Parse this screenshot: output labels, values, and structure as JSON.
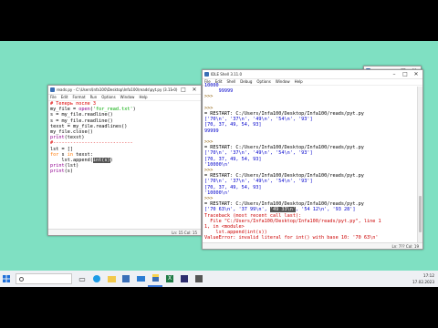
{
  "editor_window": {
    "title": "reads.py - C:\\Users\\Infa100\\Desktop\\Infa100\\reads\\pyt.py (3.11.0)",
    "menu": [
      "File",
      "Edit",
      "Format",
      "Run",
      "Options",
      "Window",
      "Help"
    ],
    "status": "Ln: 15   Col: 15"
  },
  "shell_window": {
    "title": "IDLE Shell 3.11.0",
    "menu": [
      "File",
      "Edit",
      "Shell",
      "Debug",
      "Options",
      "Window",
      "Help"
    ],
    "status": "Ln: 7??   Col: 19",
    "out_top1": "10000",
    "out_top2": "99999",
    "prompt": ">>>",
    "restart": "= RESTART: C:/Users/Infa100/Desktop/Infa100/reads/pyt.py",
    "list_str": "['70\\n', '37\\n', '49\\n', '54\\n', '93']",
    "list_int": "[70, 37, 49, 54, 93]",
    "out_99999": "99999",
    "out_10000": "'10000\\n'",
    "bad_pre": "['70 63\\n', '37 99\\n', ",
    "bad_sel": "'49 33\\n'",
    "bad_post": ", '54 12\\n', '93 28']",
    "tb_line1": "Traceback (most recent call last):",
    "tb_line2": "  File \"C:/Users/Infa100/Desktop/Infa100/reads/pyt.py\", line 1",
    "tb_line3": "1, in <module>",
    "tb_line4": "    lst.append(int(s))",
    "tb_line5": "ValueError: invalid literal for int() with base 10: '70 63\\n'"
  },
  "small_window": {
    "title": "..."
  },
  "taskbar": {
    "search_placeholder": "",
    "time": "17:12",
    "date": "17.02.2023"
  }
}
